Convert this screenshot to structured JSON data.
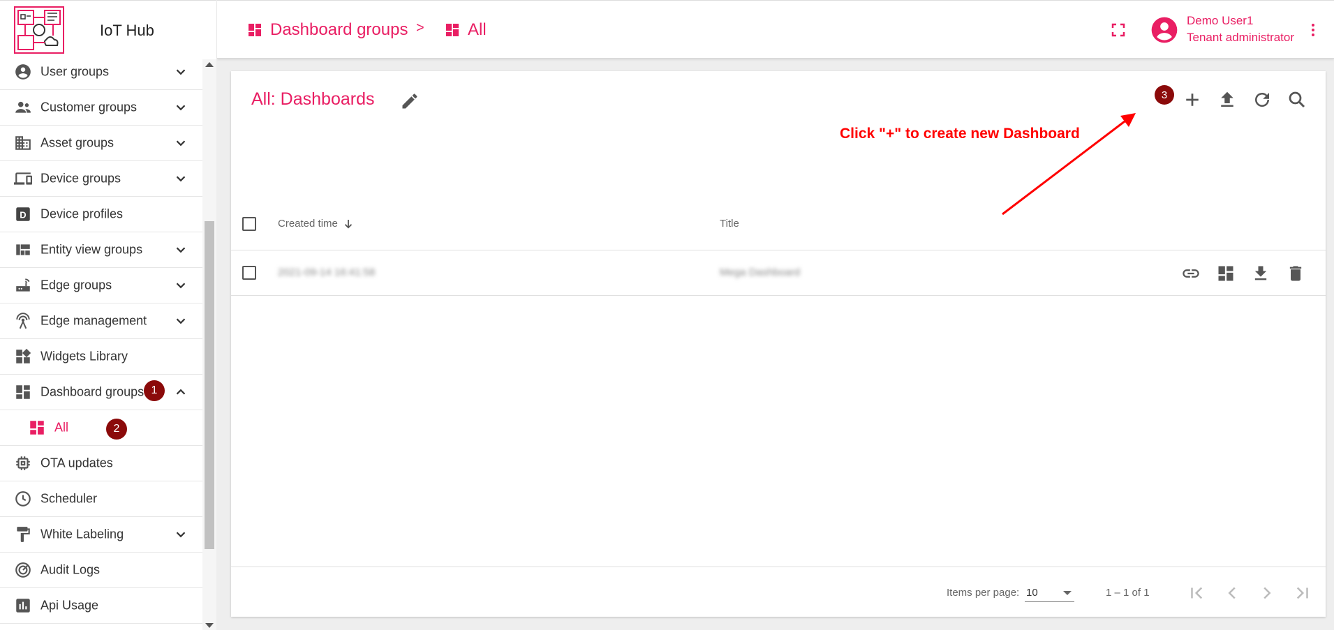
{
  "app": {
    "name": "IoT Hub"
  },
  "breadcrumb": [
    {
      "label": "Dashboard groups",
      "icon": "dashboard-icon"
    },
    {
      "label": "All",
      "icon": "dashboard-icon"
    }
  ],
  "breadcrumb_separator": ">",
  "user": {
    "name": "Demo User1",
    "role": "Tenant administrator"
  },
  "sidebar": {
    "items": [
      {
        "label": "User groups",
        "icon": "account-circle-icon",
        "expandable": true
      },
      {
        "label": "Customer groups",
        "icon": "supervisor-icon",
        "expandable": true
      },
      {
        "label": "Asset groups",
        "icon": "domain-icon",
        "expandable": true
      },
      {
        "label": "Device groups",
        "icon": "devices-icon",
        "expandable": true
      },
      {
        "label": "Device profiles",
        "icon": "device-profile-icon",
        "expandable": false
      },
      {
        "label": "Entity view groups",
        "icon": "view-quilt-icon",
        "expandable": true
      },
      {
        "label": "Edge groups",
        "icon": "router-icon",
        "expandable": true
      },
      {
        "label": "Edge management",
        "icon": "settings-input-antenna-icon",
        "expandable": true
      },
      {
        "label": "Widgets Library",
        "icon": "widgets-icon",
        "expandable": false
      },
      {
        "label": "Dashboard groups",
        "icon": "dashboard-icon",
        "expandable": true,
        "expanded": true,
        "badge": "1"
      },
      {
        "label": "All",
        "icon": "dashboard-icon",
        "sub": true,
        "badge": "2"
      },
      {
        "label": "OTA updates",
        "icon": "memory-icon",
        "expandable": false
      },
      {
        "label": "Scheduler",
        "icon": "clock-icon",
        "expandable": false
      },
      {
        "label": "White Labeling",
        "icon": "format-paint-icon",
        "expandable": true
      },
      {
        "label": "Audit Logs",
        "icon": "track-changes-icon",
        "expandable": false
      },
      {
        "label": "Api Usage",
        "icon": "insert-chart-icon",
        "expandable": false
      }
    ]
  },
  "main": {
    "title": "All: Dashboards",
    "toolbar_badge": "3",
    "annotation": "Click \"+\" to create new Dashboard",
    "table": {
      "columns": [
        "Created time",
        "Title"
      ],
      "rows": [
        {
          "created": "2021-09-14 16:41:58",
          "title": "Mega Dashboard"
        }
      ]
    },
    "footer": {
      "items_per_page_label": "Items per page:",
      "items_per_page": "10",
      "range": "1 – 1 of 1"
    }
  },
  "colors": {
    "accent": "#e91e63",
    "badge": "#8b0a0a",
    "annotation": "#ff0000"
  }
}
